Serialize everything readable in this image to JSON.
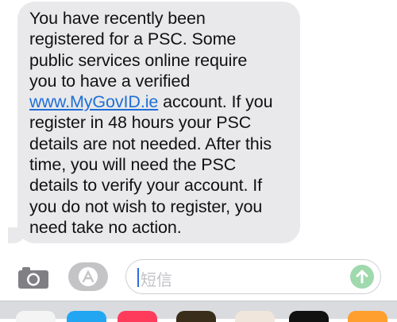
{
  "message": {
    "lines": [
      "You have recently been",
      "registered for a PSC. Some",
      "public services online require",
      "you to have a verified",
      "account. If you",
      "register in 48 hours your PSC",
      "details are not needed. After this",
      "time, you will need the PSC",
      "details to verify your account. If",
      "you do not wish to register, you",
      "need take no action."
    ],
    "link_text": "www.MyGovID.ie"
  },
  "compose": {
    "placeholder": "短信"
  },
  "icons": {
    "camera": "camera-icon",
    "apps": "app-store-icon",
    "send": "send-arrow-icon"
  },
  "colors": {
    "bubble": "#e9e9eb",
    "link": "#1f6fd6",
    "send": "#9fd9ad"
  }
}
